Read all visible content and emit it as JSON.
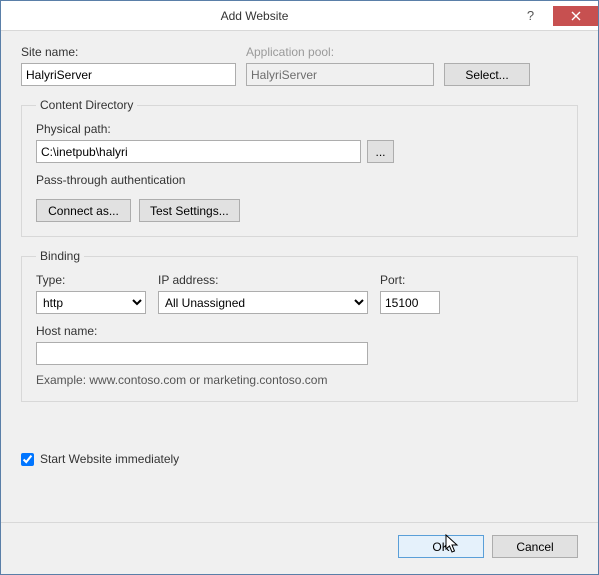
{
  "window": {
    "title": "Add Website"
  },
  "tb": {
    "help": "?",
    "close": "×"
  },
  "labels": {
    "site_name": "Site name:",
    "app_pool": "Application pool:",
    "select": "Select...",
    "content_dir": "Content Directory",
    "phys_path": "Physical path:",
    "browse": "...",
    "passthru": "Pass-through authentication",
    "connect_as": "Connect as...",
    "test_settings": "Test Settings...",
    "binding": "Binding",
    "type": "Type:",
    "ip": "IP address:",
    "port": "Port:",
    "host": "Host name:",
    "example": "Example: www.contoso.com or marketing.contoso.com",
    "start_immediately": "Start Website immediately",
    "ok": "OK",
    "cancel": "Cancel"
  },
  "values": {
    "site_name": "HalyriServer",
    "app_pool": "HalyriServer",
    "phys_path": "C:\\inetpub\\halyri",
    "type": "http",
    "ip": "All Unassigned",
    "port": "15100",
    "host": "",
    "start_checked": true
  }
}
